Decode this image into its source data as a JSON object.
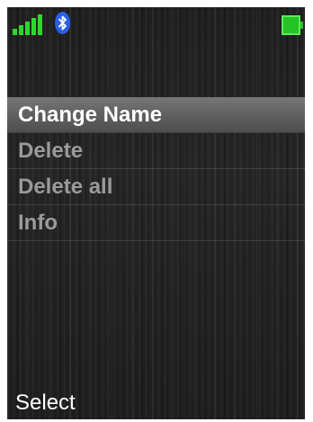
{
  "status_bar": {
    "signal_icon": "signal-strength-icon",
    "signal_level": 5,
    "bluetooth_icon": "bluetooth-icon",
    "battery_icon": "battery-full-icon",
    "battery_level": 1.0,
    "accent_color": "#2fd62f"
  },
  "menu": {
    "items": [
      {
        "label": "Change Name",
        "selected": true
      },
      {
        "label": "Delete",
        "selected": false
      },
      {
        "label": "Delete all",
        "selected": false
      },
      {
        "label": "Info",
        "selected": false
      }
    ]
  },
  "softkeys": {
    "left_label": "Select"
  }
}
